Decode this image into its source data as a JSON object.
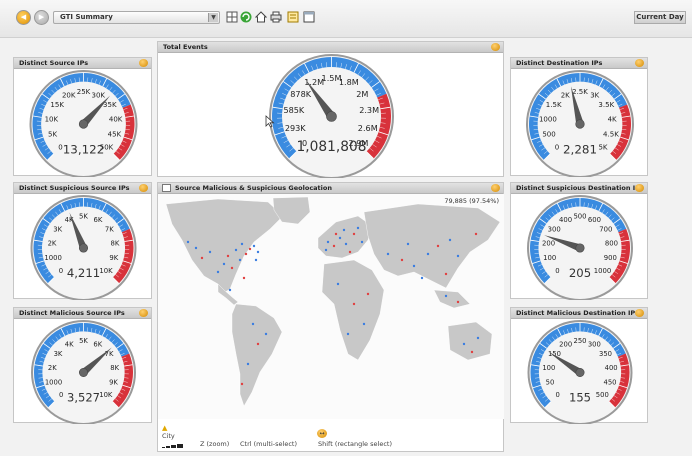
{
  "toolbar": {
    "dashboard_name": "GTI Summary",
    "time_range": "Current Day",
    "icons": [
      "back-icon",
      "forward-icon",
      "layout-icon",
      "refresh-icon",
      "home-icon",
      "print-icon",
      "edit-icon",
      "window-icon"
    ]
  },
  "colors": {
    "blue": "#3a8be0",
    "red": "#d8323b",
    "panel_header": "#d5d5d5",
    "map_land": "#c8c8c8"
  },
  "panels": {
    "distinct_source": {
      "title": "Distinct Source IPs",
      "value": "13,122",
      "labels": [
        "0",
        "5K",
        "10K",
        "15K",
        "20K",
        "25K",
        "30K",
        "35K",
        "40K",
        "45K",
        "50K"
      ],
      "needle": 0.66
    },
    "total_events": {
      "title": "Total Events",
      "value": "1,081,808",
      "labels": [
        "0",
        "293K",
        "585K",
        "878K",
        "1.2M",
        "1.5M",
        "1.8M",
        "2M",
        "2.3M",
        "2.6M",
        "2.9M"
      ],
      "needle": 0.37
    },
    "distinct_dest": {
      "title": "Distinct Destination IPs",
      "value": "2,281",
      "labels": [
        "0",
        "500",
        "1000",
        "1.5K",
        "2K",
        "2.5K",
        "3K",
        "3.5K",
        "4K",
        "4.5K",
        "5K"
      ],
      "needle": 0.45
    },
    "susp_source": {
      "title": "Distinct Suspicious Source IPs",
      "value": "4,211",
      "labels": [
        "0",
        "1000",
        "2K",
        "3K",
        "4K",
        "5K",
        "6K",
        "7K",
        "8K",
        "9K",
        "10K"
      ],
      "needle": 0.42
    },
    "susp_dest": {
      "title": "Distinct Suspicious Destination IPs",
      "value": "205",
      "labels": [
        "0",
        "100",
        "200",
        "300",
        "400",
        "500",
        "600",
        "700",
        "800",
        "900",
        "1000"
      ],
      "needle": 0.24
    },
    "mal_source": {
      "title": "Distinct Malicious Source IPs",
      "value": "3,527",
      "labels": [
        "0",
        "1000",
        "2K",
        "3K",
        "4K",
        "5K",
        "6K",
        "7K",
        "8K",
        "9K",
        "10K"
      ],
      "needle": 0.68
    },
    "mal_dest": {
      "title": "Distinct Malicious Destination IPs",
      "value": "155",
      "labels": [
        "0",
        "50",
        "100",
        "150",
        "200",
        "250",
        "300",
        "350",
        "400",
        "450",
        "500"
      ],
      "needle": 0.29
    },
    "geo": {
      "title": "Source Malicious & Suspicious Geolocation",
      "count": "79,885 (97.54%)",
      "legend": "City",
      "help_zoom": "Z (zoom)",
      "help_multi": "Ctrl (multi-select)",
      "help_rect": "Shift (rectangle select)"
    }
  }
}
